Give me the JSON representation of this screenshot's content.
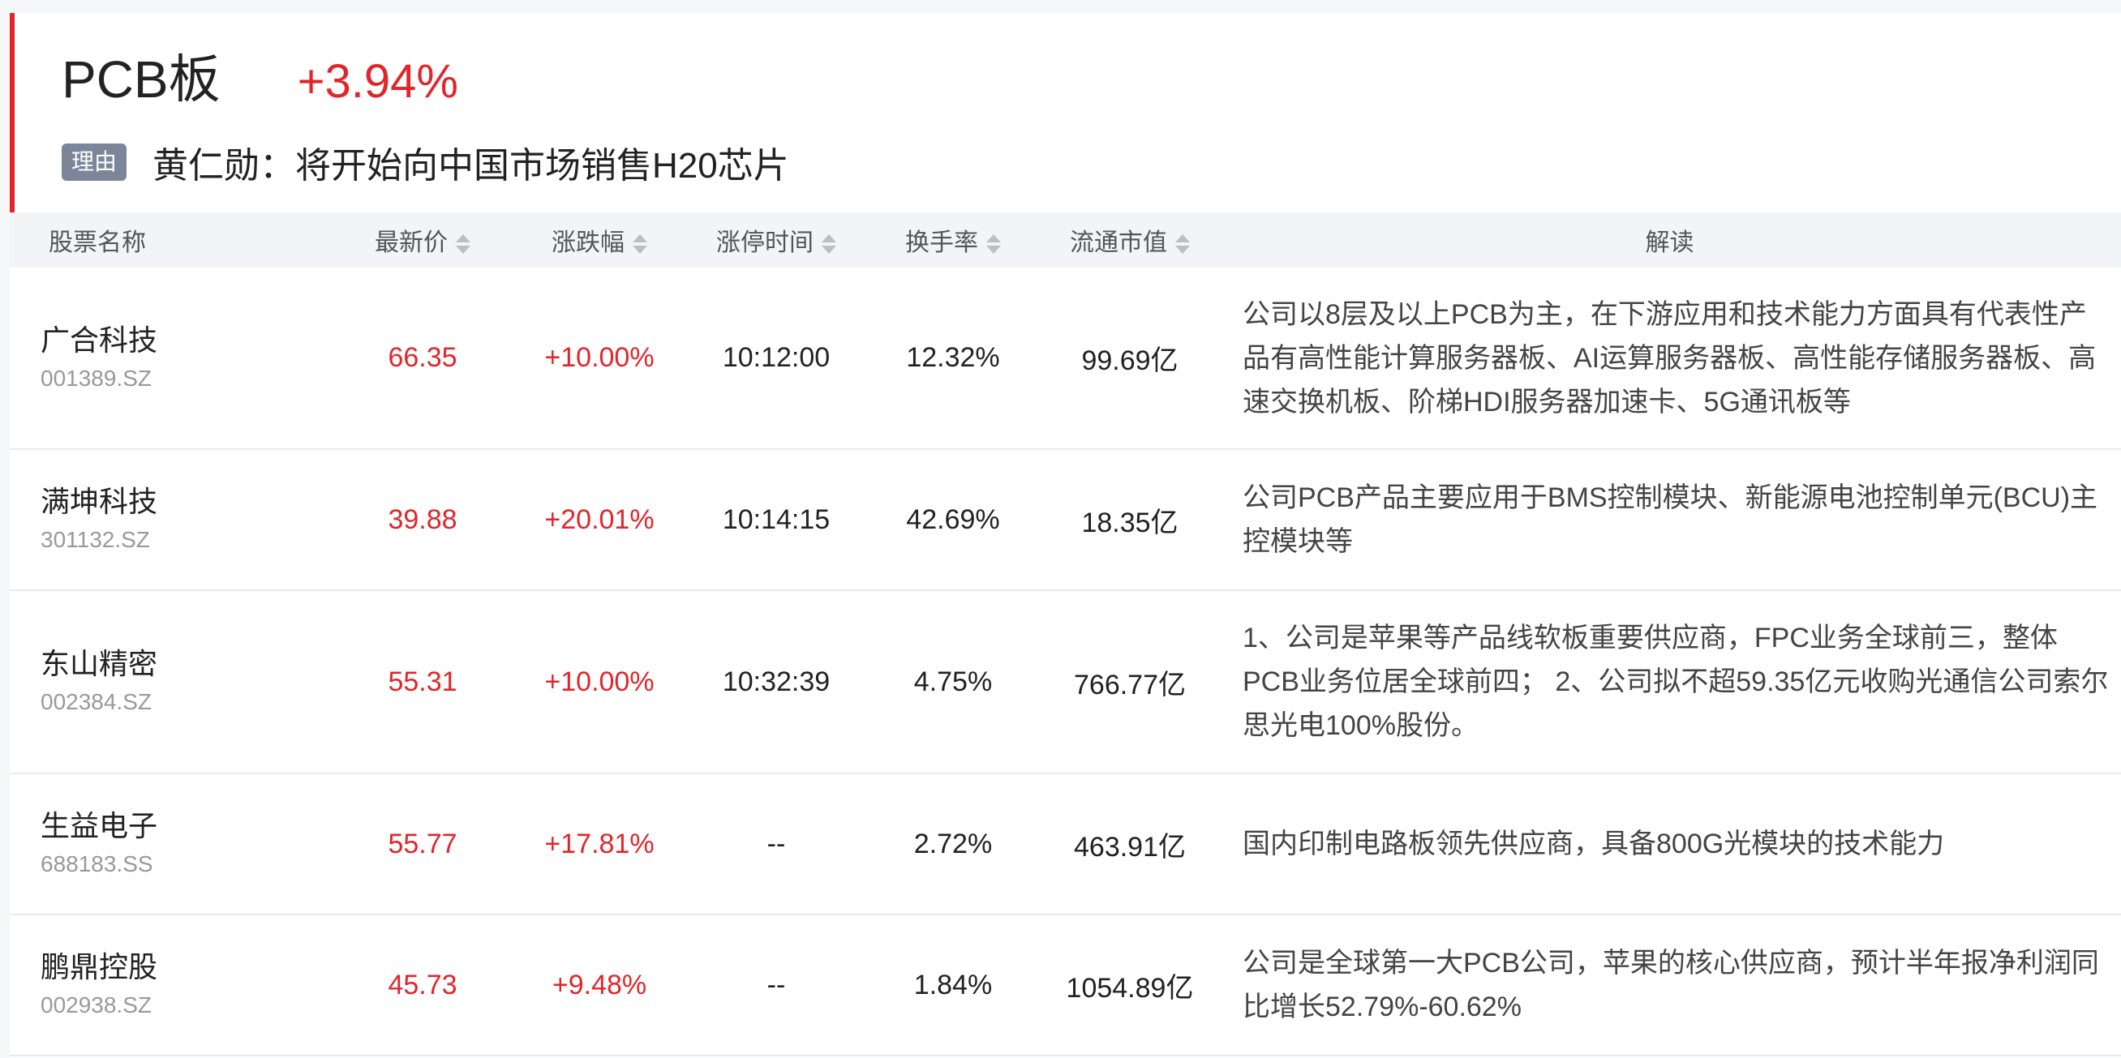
{
  "board": {
    "name": "PCB板",
    "change": "+3.94%",
    "reason_tag": "理由",
    "reason_text": "黄仁勋：将开始向中国市场销售H20芯片"
  },
  "table": {
    "headers": {
      "name": "股票名称",
      "price": "最新价",
      "change": "涨跌幅",
      "limit_time": "涨停时间",
      "turnover": "换手率",
      "market_cap": "流通市值",
      "desc": "解读"
    },
    "rows": [
      {
        "name": "广合科技",
        "code": "001389.SZ",
        "price": "66.35",
        "change": "+10.00%",
        "limit_time": "10:12:00",
        "turnover": "12.32%",
        "market_cap": "99.69亿",
        "desc": "公司以8层及以上PCB为主，在下游应用和技术能力方面具有代表性产品有高性能计算服务器板、AI运算服务器板、高性能存储服务器板、高速交换机板、阶梯HDI服务器加速卡、5G通讯板等"
      },
      {
        "name": "满坤科技",
        "code": "301132.SZ",
        "price": "39.88",
        "change": "+20.01%",
        "limit_time": "10:14:15",
        "turnover": "42.69%",
        "market_cap": "18.35亿",
        "desc": "公司PCB产品主要应用于BMS控制模块、新能源电池控制单元(BCU)主控模块等"
      },
      {
        "name": "东山精密",
        "code": "002384.SZ",
        "price": "55.31",
        "change": "+10.00%",
        "limit_time": "10:32:39",
        "turnover": "4.75%",
        "market_cap": "766.77亿",
        "desc": "1、公司是苹果等产品线软板重要供应商，FPC业务全球前三，整体PCB业务位居全球前四； 2、公司拟不超59.35亿元收购光通信公司索尔思光电100%股份。"
      },
      {
        "name": "生益电子",
        "code": "688183.SS",
        "price": "55.77",
        "change": "+17.81%",
        "limit_time": "--",
        "turnover": "2.72%",
        "market_cap": "463.91亿",
        "desc": "国内印制电路板领先供应商，具备800G光模块的技术能力"
      },
      {
        "name": "鹏鼎控股",
        "code": "002938.SZ",
        "price": "45.73",
        "change": "+9.48%",
        "limit_time": "--",
        "turnover": "1.84%",
        "market_cap": "1054.89亿",
        "desc": "公司是全球第一大PCB公司，苹果的核心供应商，预计半年报净利润同比增长52.79%-60.62%"
      }
    ]
  },
  "colors": {
    "accent_red": "#e1262b",
    "tag_bg": "#7b8699",
    "header_bg": "#f3f4f6"
  }
}
